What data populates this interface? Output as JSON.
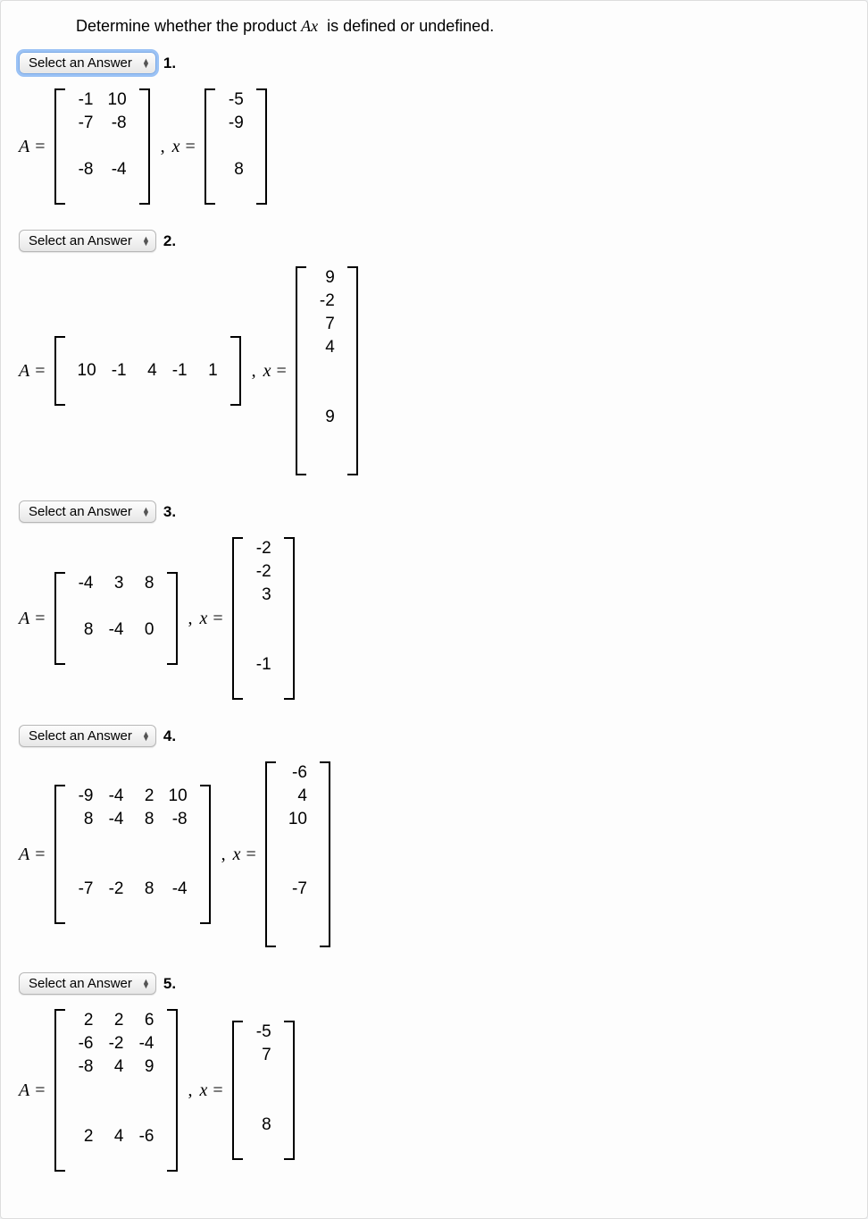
{
  "prompt_prefix": "Determine whether the product ",
  "prompt_var": "Ax",
  "prompt_suffix": " is defined or undefined.",
  "select_placeholder": "Select an Answer",
  "A_label": "A",
  "x_label": "x",
  "equals": "=",
  "comma": ",",
  "questions": [
    {
      "num": "1.",
      "focused": true,
      "A_rows": [
        [
          "-1",
          "10"
        ],
        [
          "-7",
          "-8"
        ],
        [
          "",
          ""
        ],
        [
          "-8",
          "-4"
        ],
        [
          "",
          ""
        ]
      ],
      "x_rows": [
        [
          "-5"
        ],
        [
          "-9"
        ],
        [
          ""
        ],
        [
          "8"
        ],
        [
          ""
        ]
      ]
    },
    {
      "num": "2.",
      "focused": false,
      "A_rows": [
        [
          "10",
          "-1",
          "4",
          "-1",
          "1"
        ]
      ],
      "A_pad_top": 1,
      "A_pad_bottom": 1,
      "x_rows": [
        [
          "9"
        ],
        [
          "-2"
        ],
        [
          "7"
        ],
        [
          "4"
        ],
        [
          ""
        ],
        [
          ""
        ],
        [
          "9"
        ],
        [
          ""
        ],
        [
          ""
        ]
      ]
    },
    {
      "num": "3.",
      "focused": false,
      "A_rows": [
        [
          "-4",
          "3",
          "8"
        ],
        [
          "",
          "",
          ""
        ],
        [
          "8",
          "-4",
          "0"
        ],
        [
          "",
          "",
          ""
        ]
      ],
      "x_rows": [
        [
          "-2"
        ],
        [
          "-2"
        ],
        [
          "3"
        ],
        [
          ""
        ],
        [
          ""
        ],
        [
          "-1"
        ],
        [
          ""
        ]
      ]
    },
    {
      "num": "4.",
      "focused": false,
      "A_rows": [
        [
          "-9",
          "-4",
          "2",
          "10"
        ],
        [
          "8",
          "-4",
          "8",
          "-8"
        ],
        [
          "",
          "",
          "",
          ""
        ],
        [
          "",
          "",
          "",
          ""
        ],
        [
          "-7",
          "-2",
          "8",
          "-4"
        ],
        [
          "",
          "",
          "",
          ""
        ]
      ],
      "x_rows": [
        [
          "-6"
        ],
        [
          "4"
        ],
        [
          "10"
        ],
        [
          ""
        ],
        [
          ""
        ],
        [
          "-7"
        ],
        [
          ""
        ],
        [
          ""
        ]
      ]
    },
    {
      "num": "5.",
      "focused": false,
      "A_rows": [
        [
          "2",
          "2",
          "6"
        ],
        [
          "-6",
          "-2",
          "-4"
        ],
        [
          "-8",
          "4",
          "9"
        ],
        [
          "",
          "",
          ""
        ],
        [
          "",
          "",
          ""
        ],
        [
          "2",
          "4",
          "-6"
        ],
        [
          "",
          "",
          ""
        ]
      ],
      "x_rows": [
        [
          "-5"
        ],
        [
          "7"
        ],
        [
          ""
        ],
        [
          ""
        ],
        [
          "8"
        ],
        [
          ""
        ]
      ]
    }
  ]
}
